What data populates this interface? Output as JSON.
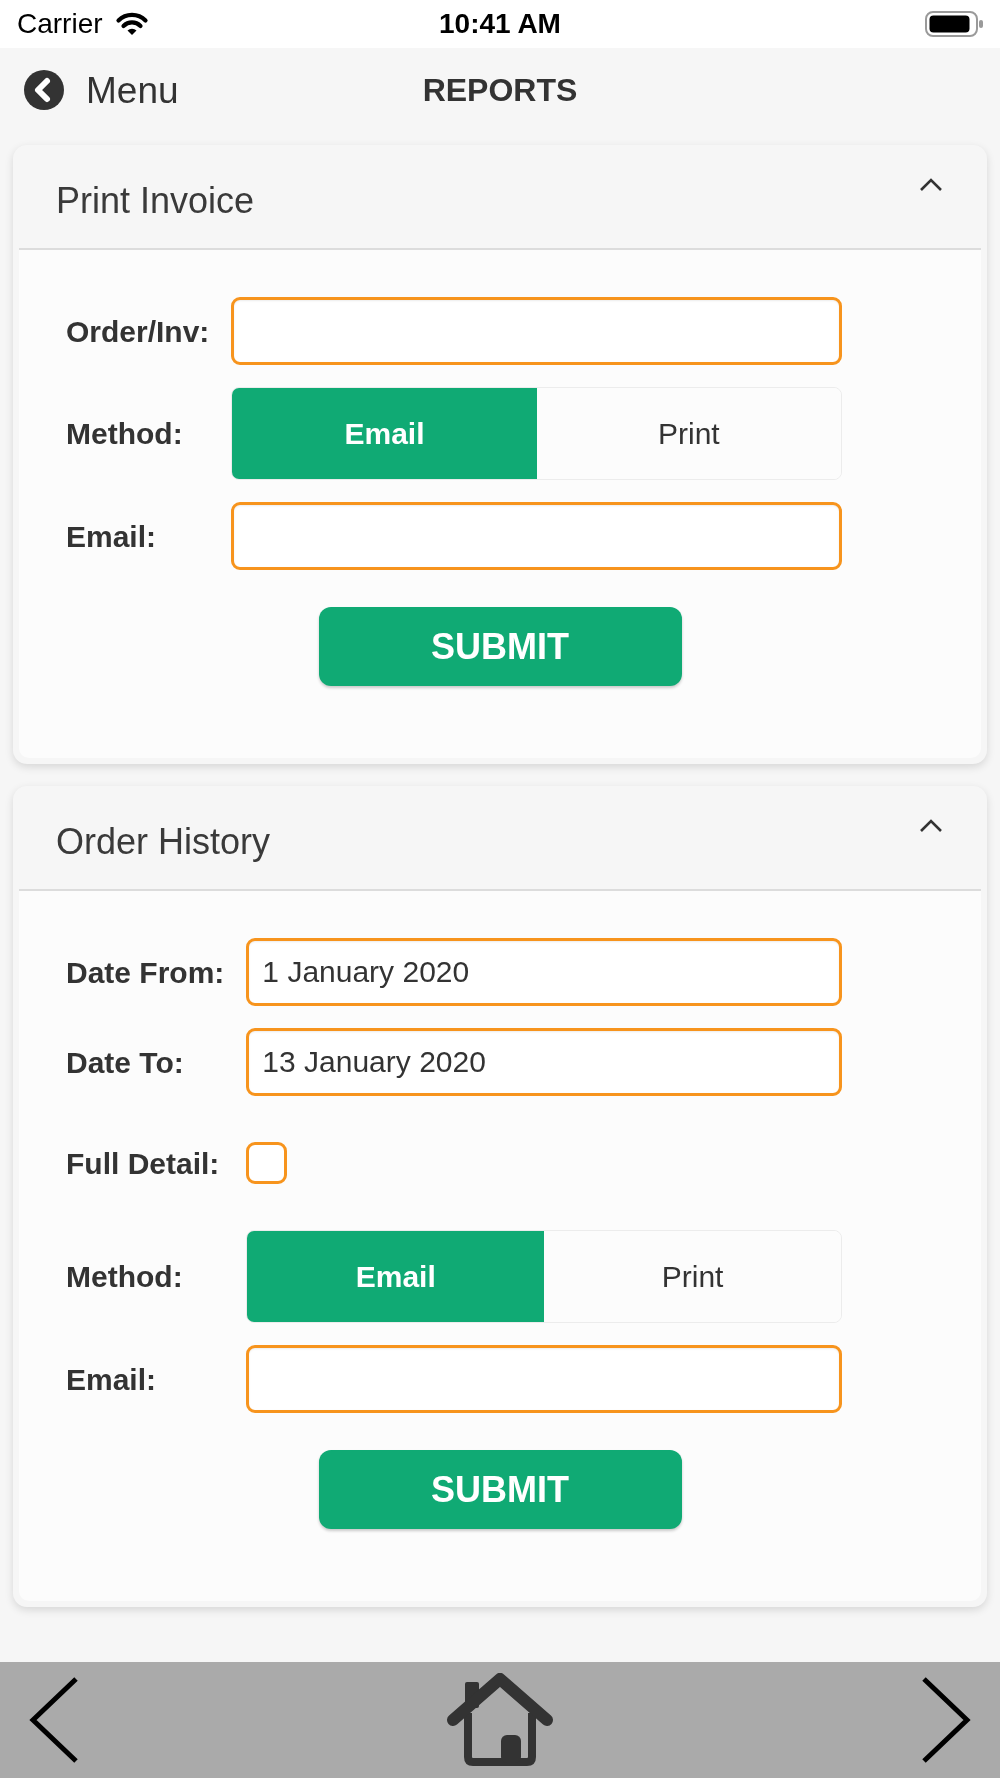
{
  "status_bar": {
    "carrier": "Carrier",
    "time": "10:41 AM"
  },
  "nav_bar": {
    "back_label": "Menu",
    "title": "REPORTS"
  },
  "sections": [
    {
      "title": "Print Invoice",
      "expanded": true,
      "fields": [
        {
          "kind": "input",
          "label": "Order/Inv:"
        },
        {
          "kind": "segmented",
          "label": "Method:",
          "options": [
            {
              "label": "Email",
              "selected": true
            },
            {
              "label": "Print",
              "selected": false
            }
          ]
        },
        {
          "kind": "input",
          "label": "Email:"
        }
      ],
      "submit_label": "SUBMIT"
    },
    {
      "title": "Order History",
      "expanded": true,
      "fields": [
        {
          "kind": "input",
          "label": "Date From:",
          "value": "1 January 2020"
        },
        {
          "kind": "input",
          "label": "Date To:",
          "value": "13 January 2020"
        },
        {
          "kind": "checkbox",
          "label": "Full Detail:",
          "checked": false
        },
        {
          "kind": "segmented",
          "label": "Method:",
          "options": [
            {
              "label": "Email",
              "selected": true
            },
            {
              "label": "Print",
              "selected": false
            }
          ]
        },
        {
          "kind": "input",
          "label": "Email:"
        }
      ],
      "submit_label": "SUBMIT"
    }
  ]
}
